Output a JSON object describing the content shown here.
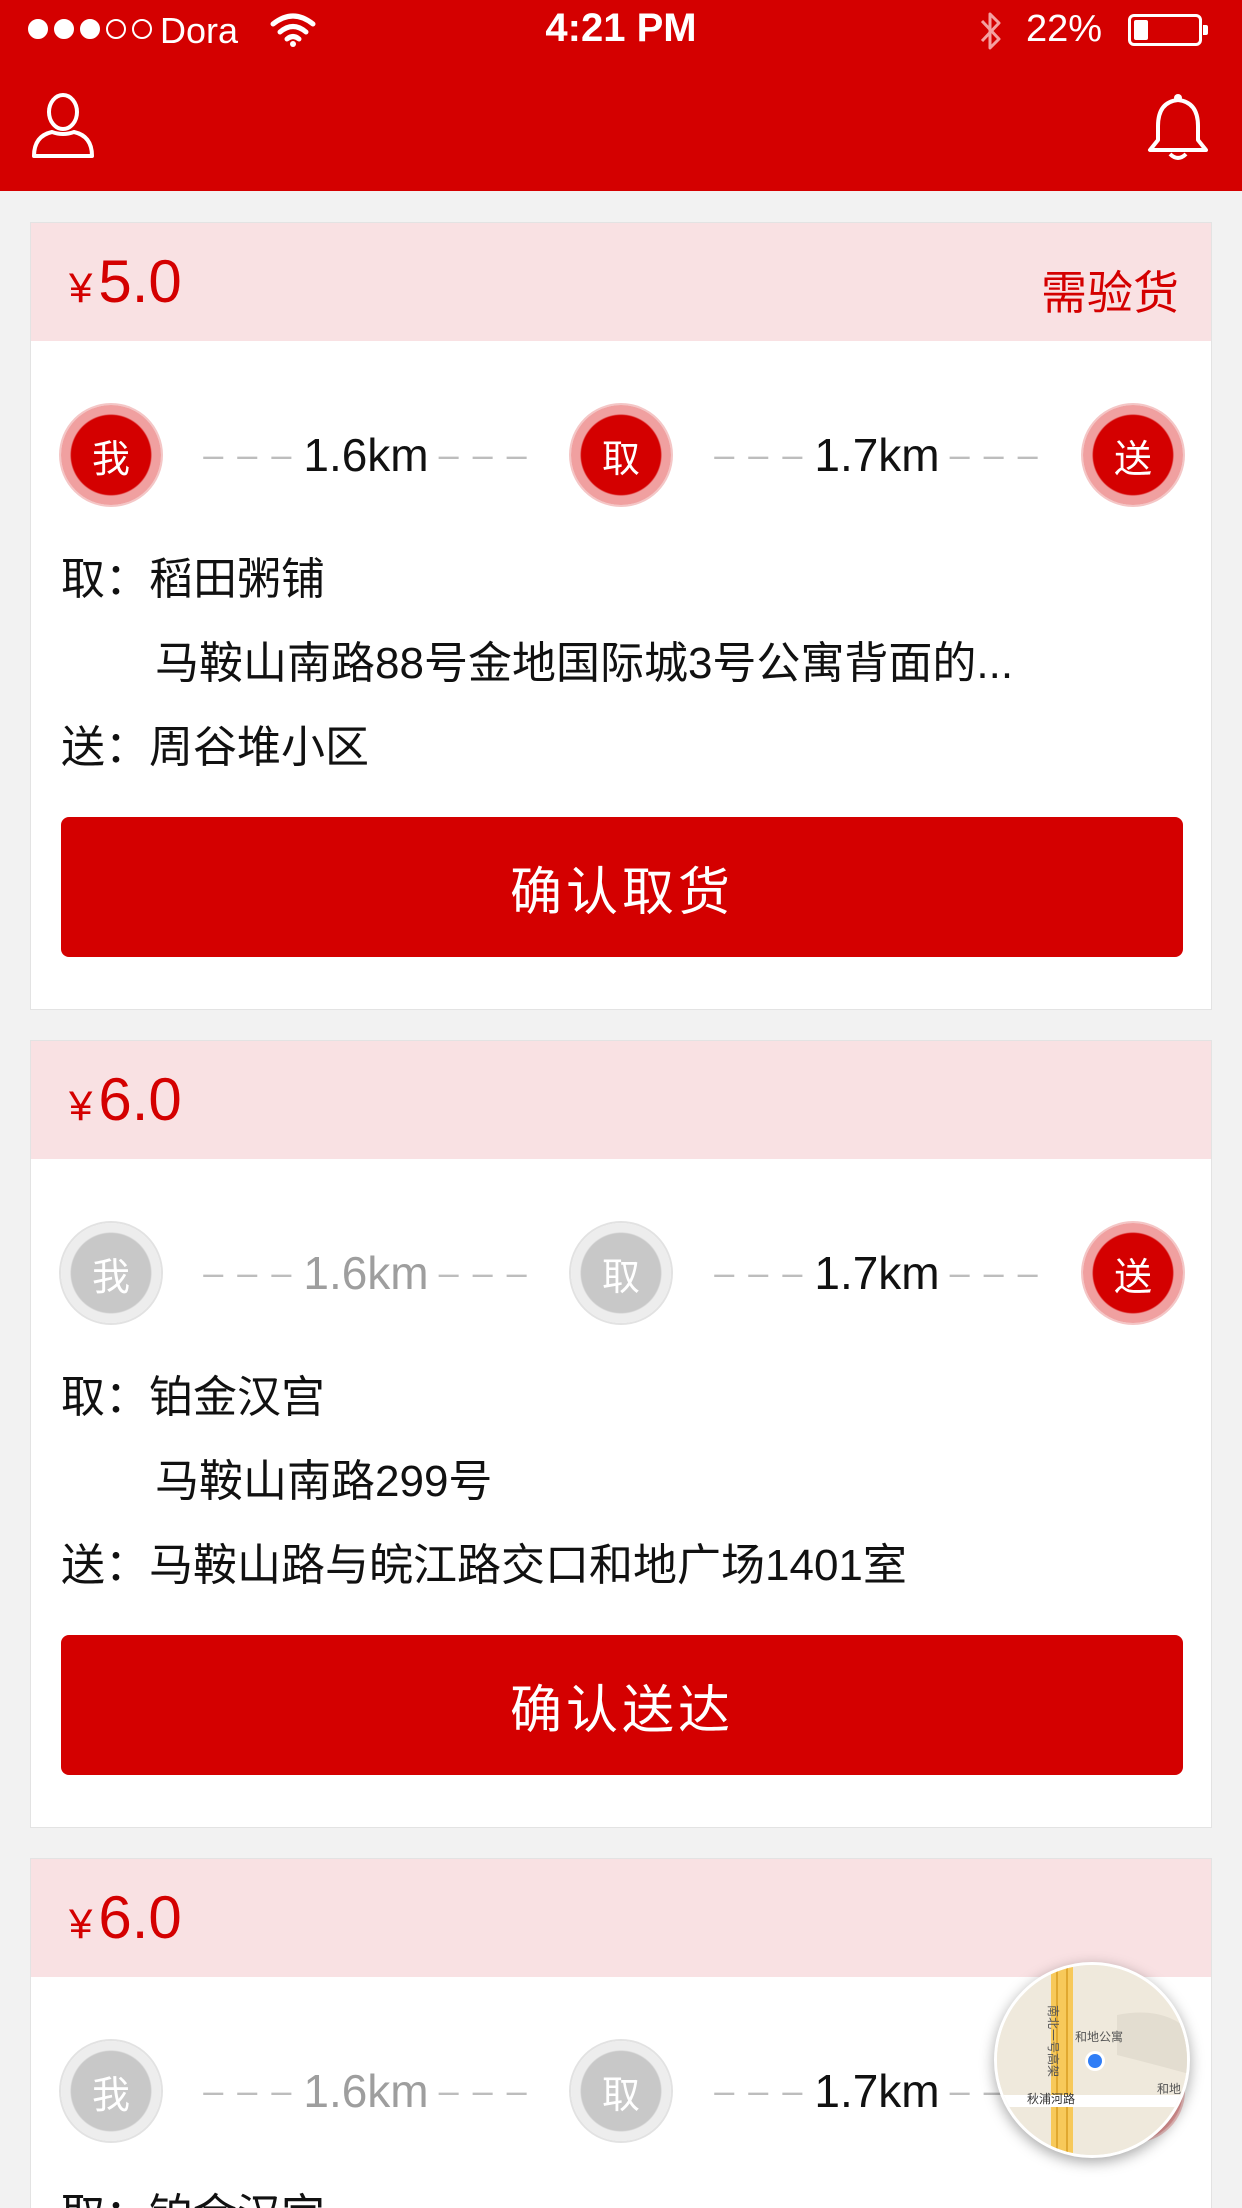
{
  "status_bar": {
    "carrier": "Dora",
    "time": "4:21 PM",
    "battery": "22%"
  },
  "header": {
    "left_icon": "user-icon",
    "right_icon": "bell-icon"
  },
  "orders": [
    {
      "currency": "¥",
      "price": "5.0",
      "tag": "需验货",
      "route": {
        "me": "我",
        "pickup": "取",
        "deliver": "送",
        "dist1": "1.6km",
        "dist2": "1.7km",
        "dash": "– – –"
      },
      "pickup_prefix": "取：",
      "pickup_name": "稻田粥铺",
      "pickup_address": "马鞍山南路88号金地国际城3号公寓背面的...",
      "deliver_prefix": "送：",
      "deliver_address": "周谷堆小区",
      "action": "确认取货"
    },
    {
      "currency": "¥",
      "price": "6.0",
      "tag": "",
      "route": {
        "me": "我",
        "pickup": "取",
        "deliver": "送",
        "dist1": "1.6km",
        "dist2": "1.7km",
        "dash": "– – –"
      },
      "pickup_prefix": "取：",
      "pickup_name": "铂金汉宫",
      "pickup_address": "马鞍山南路299号",
      "deliver_prefix": "送：",
      "deliver_address": "马鞍山路与皖江路交口和地广场1401室",
      "action": "确认送达"
    },
    {
      "currency": "¥",
      "price": "6.0",
      "tag": "",
      "route": {
        "me": "我",
        "pickup": "取",
        "deliver": "送",
        "dist1": "1.6km",
        "dist2": "1.7km",
        "dash": "– – –"
      },
      "pickup_prefix": "取：",
      "pickup_name": "铂金汉宫"
    }
  ],
  "map": {
    "labels": [
      "南北一号高架",
      "和地公寓",
      "秋浦河路",
      "和地"
    ]
  },
  "colors": {
    "brand": "#d40000",
    "card_header": "#f9e1e3"
  }
}
